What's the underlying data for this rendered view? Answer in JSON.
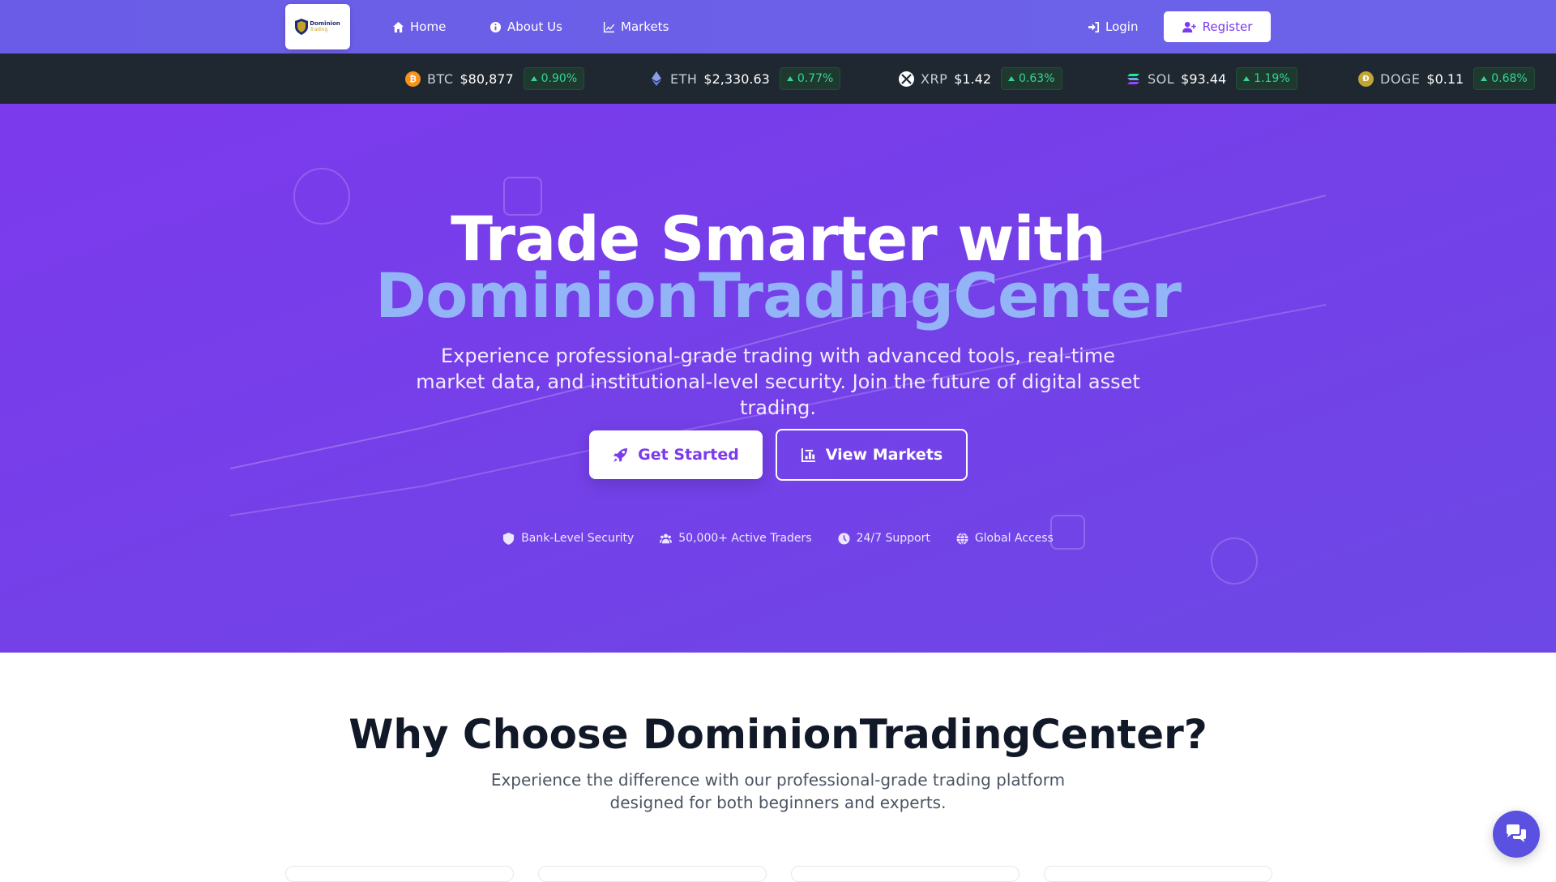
{
  "nav": {
    "logo_line1": "Dominion",
    "logo_line2": "Trading",
    "links": [
      {
        "label": "Home",
        "icon": "home-icon"
      },
      {
        "label": "About Us",
        "icon": "info-icon"
      },
      {
        "label": "Markets",
        "icon": "chart-line-icon"
      }
    ],
    "login_label": "Login",
    "register_label": "Register"
  },
  "ticker": [
    {
      "symbol": "BTC",
      "price": "$80,877",
      "change": "0.90%",
      "icon": "bitcoin-icon",
      "color": "#f7931a"
    },
    {
      "symbol": "ETH",
      "price": "$2,330.63",
      "change": "0.77%",
      "icon": "ethereum-icon",
      "color": "#627eea"
    },
    {
      "symbol": "XRP",
      "price": "$1.42",
      "change": "0.63%",
      "icon": "xrp-icon",
      "color": "#ffffff"
    },
    {
      "symbol": "SOL",
      "price": "$93.44",
      "change": "1.19%",
      "icon": "solana-icon",
      "color": "#14f195"
    },
    {
      "symbol": "DOGE",
      "price": "$0.11",
      "change": "0.68%",
      "icon": "doge-icon",
      "color": "#c2a633"
    }
  ],
  "hero": {
    "title_line1": "Trade Smarter with",
    "title_line2": "DominionTradingCenter",
    "subtitle": "Experience professional-grade trading with advanced tools, real-time market data, and institutional-level security. Join the future of digital asset trading.",
    "primary_button": "Get Started",
    "secondary_button": "View Markets",
    "features": [
      {
        "label": "Bank-Level Security",
        "icon": "shield-icon"
      },
      {
        "label": "50,000+ Active Traders",
        "icon": "users-icon"
      },
      {
        "label": "24/7 Support",
        "icon": "clock-icon"
      },
      {
        "label": "Global Access",
        "icon": "globe-icon"
      }
    ]
  },
  "why": {
    "title": "Why Choose DominionTradingCenter?",
    "subtitle": "Experience the difference with our professional-grade trading platform designed for both beginners and experts."
  },
  "colors": {
    "accent": "#7c3aed",
    "nav": "#6a5ce6",
    "ticker_bg": "#1f2730",
    "positive": "#34d399",
    "highlight": "#93b4f7"
  },
  "chat": {
    "icon": "chat-bubbles-icon"
  }
}
